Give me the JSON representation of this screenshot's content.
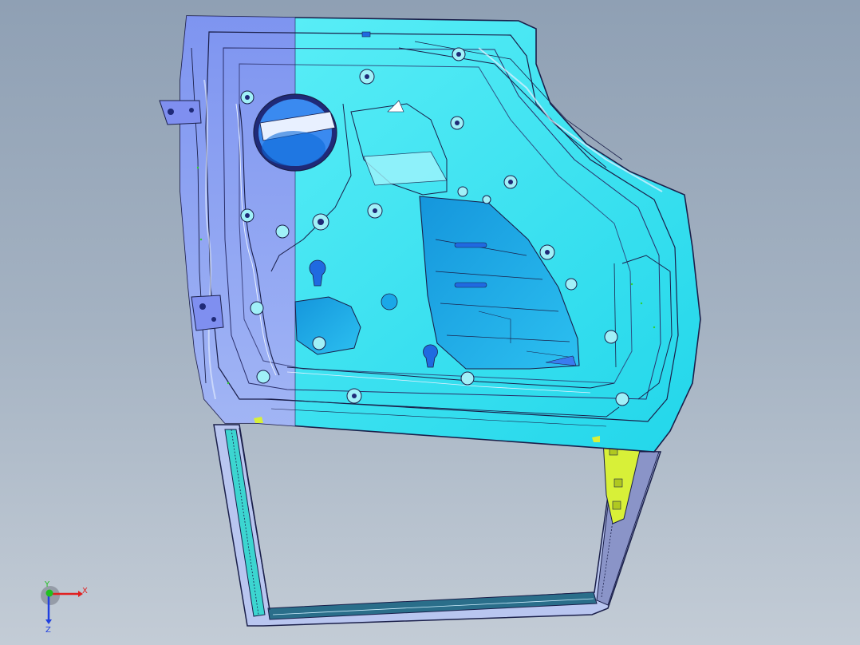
{
  "viewport": {
    "background_top": "#8fa0b4",
    "background_bottom": "#c3ccd6"
  },
  "model": {
    "colors": {
      "panel_cyan": "#33e6f0",
      "panel_violet": "#8e9cf2",
      "edge": "#1a1f4a",
      "frame": "#2a2f6a",
      "recess_blue": "#1aa8e8",
      "bracket_yellow": "#d8f038",
      "highlight_white": "#e8f0ff"
    }
  },
  "triad": {
    "x_label": "X",
    "y_label": "Y",
    "z_label": "Z",
    "x_color": "#e02020",
    "y_color": "#20c020",
    "z_color": "#2040e0"
  }
}
